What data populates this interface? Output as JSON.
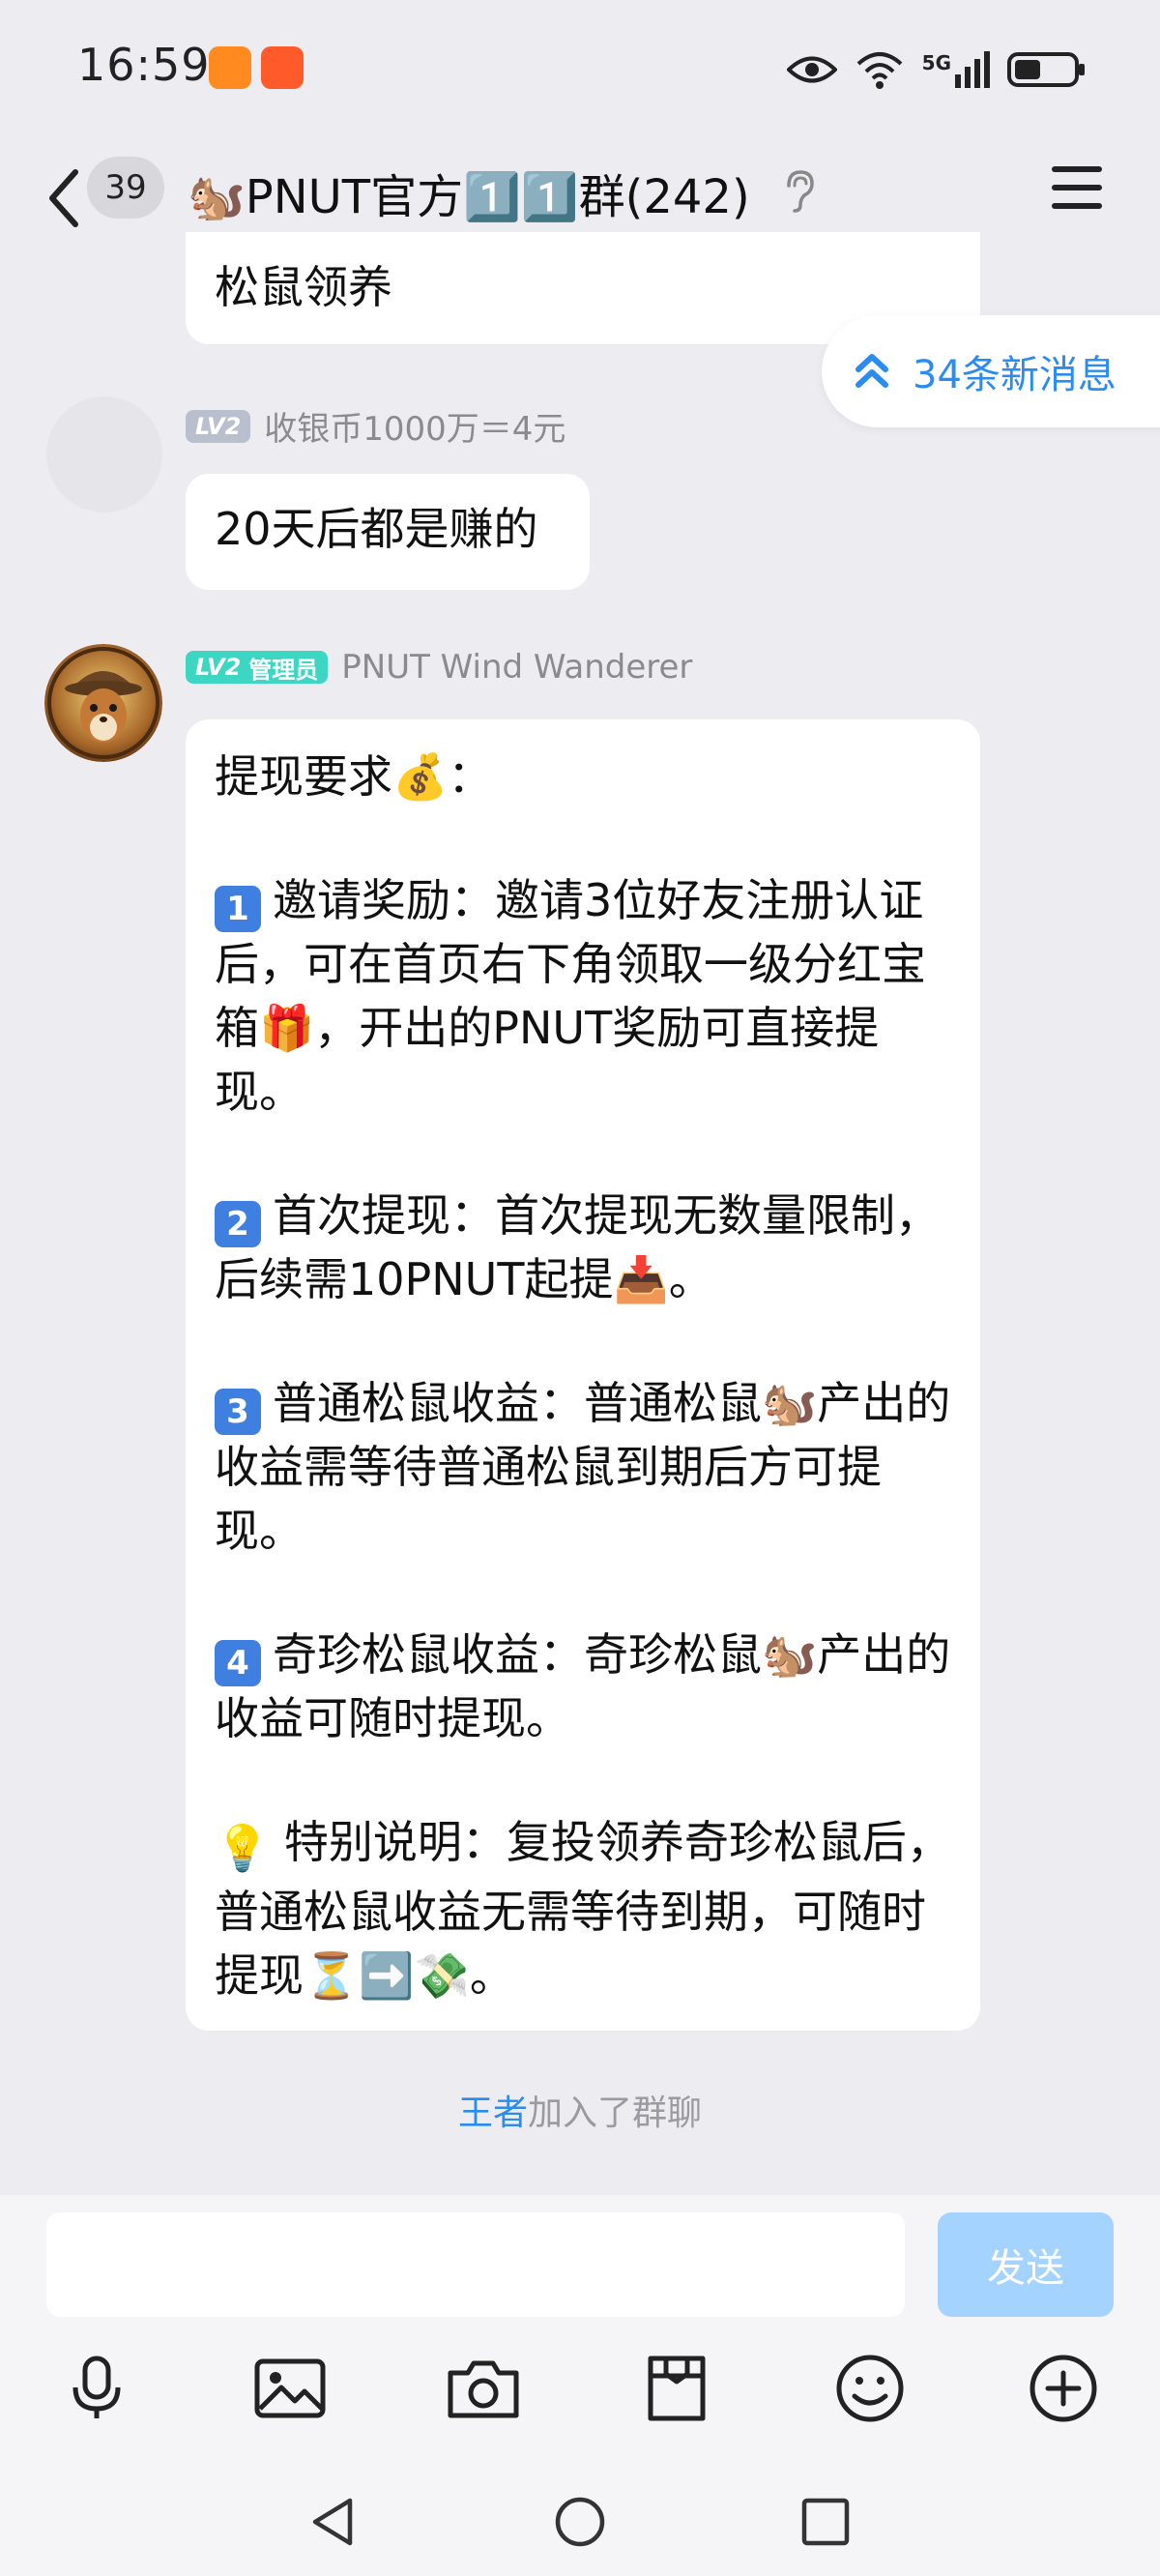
{
  "status_bar": {
    "time": "16:59",
    "network": "5G"
  },
  "header": {
    "unread_count": "39",
    "title": "🐿️PNUT官方1️⃣1️⃣群(242)"
  },
  "new_messages": {
    "label": "34条新消息"
  },
  "messages": [
    {
      "text": "松鼠领养"
    },
    {
      "level": "LV2",
      "sender": "收银币1000万＝4元",
      "text": "20天后都是赚的"
    },
    {
      "level": "LV2",
      "role": "管理员",
      "sender": "PNUT Wind Wanderer",
      "lines": [
        "提现要求💰：",
        "邀请奖励：邀请3位好友注册认证后，可在首页右下角领取一级分红宝箱🎁，开出的PNUT奖励可直接提现。",
        "首次提现：首次提现无数量限制，后续需10PNUT起提📥。",
        "普通松鼠收益：普通松鼠🐿️产出的收益需等待普通松鼠到期后方可提现。",
        "奇珍松鼠收益：奇珍松鼠🐿️产出的收益可随时提现。",
        "特别说明：复投领养奇珍松鼠后，普通松鼠收益无需等待到期，可随时提现⏳➡️💸。"
      ],
      "numbers": [
        "1",
        "2",
        "3",
        "4"
      ]
    }
  ],
  "system_notice": {
    "name": "王者",
    "text": "加入了群聊"
  },
  "composer": {
    "value": "",
    "send_label": "发送"
  },
  "toolbar": [
    "mic-icon",
    "image-icon",
    "camera-icon",
    "file-icon",
    "emoji-icon",
    "add-icon"
  ],
  "colors": {
    "accent": "#2b8cf0",
    "send_disabled": "#a4d3ff",
    "admin_badge": "#3dd6c3",
    "background": "#ececf1"
  }
}
